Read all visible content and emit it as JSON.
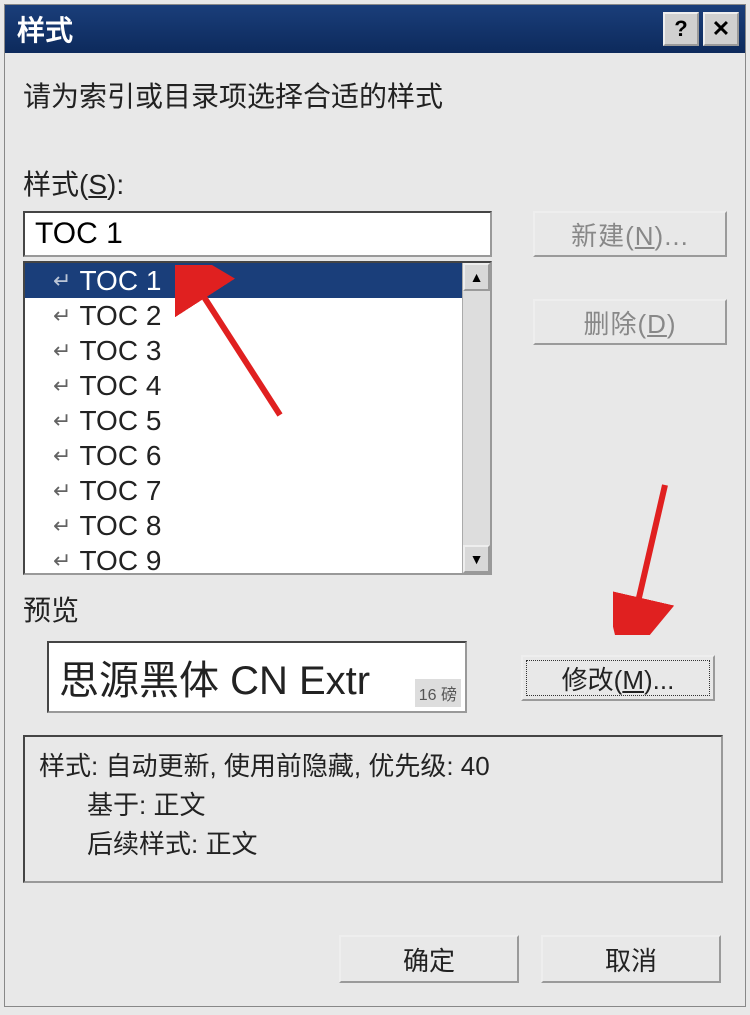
{
  "window": {
    "title": "样式"
  },
  "instruction": "请为索引或目录项选择合适的样式",
  "stylesLabel": "样式(",
  "stylesLabelKey": "S",
  "stylesLabelEnd": "):",
  "styleInput": "TOC 1",
  "styleItems": [
    {
      "label": "TOC 1",
      "selected": true
    },
    {
      "label": "TOC 2",
      "selected": false
    },
    {
      "label": "TOC 3",
      "selected": false
    },
    {
      "label": "TOC 4",
      "selected": false
    },
    {
      "label": "TOC 5",
      "selected": false
    },
    {
      "label": "TOC 6",
      "selected": false
    },
    {
      "label": "TOC 7",
      "selected": false
    },
    {
      "label": "TOC 8",
      "selected": false
    },
    {
      "label": "TOC 9",
      "selected": false
    }
  ],
  "buttons": {
    "new": "新建(",
    "newKey": "N",
    "newEnd": ")...",
    "delete": "删除(",
    "deleteKey": "D",
    "deleteEnd": ")",
    "modify": "修改(",
    "modifyKey": "M",
    "modifyEnd": ")...",
    "ok": "确定",
    "cancel": "取消"
  },
  "previewLabel": "预览",
  "previewText": "思源黑体 CN Extr",
  "previewSize": "16 磅",
  "description": {
    "line1": "样式: 自动更新, 使用前隐藏, 优先级: 40",
    "line2": "基于: 正文",
    "line3": "后续样式: 正文"
  }
}
